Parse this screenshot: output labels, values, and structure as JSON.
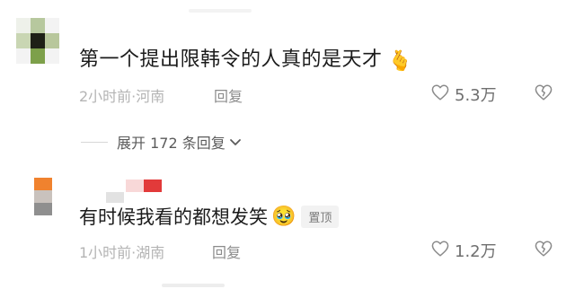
{
  "comments": [
    {
      "text": "第一个提出限韩令的人真的是天才",
      "emoji": "🫰",
      "meta": "2小时前·河南",
      "reply_label": "回复",
      "likes": "5.3万"
    },
    {
      "text": "有时候我看的都想发笑",
      "emoji": "🥹",
      "pin_label": "置顶",
      "meta": "1小时前·湖南",
      "reply_label": "回复",
      "likes": "1.2万"
    }
  ],
  "expand_replies": {
    "label": "展开 172 条回复"
  },
  "colors": {
    "text": "#1b1b1b",
    "meta": "#b4b4b4",
    "accent_red": "#e23a3a",
    "avatar_green": "#7da04a",
    "avatar_orange": "#f0822e"
  },
  "icons": {
    "like": "heart-outline-icon",
    "dislike": "broken-heart-outline-icon",
    "expand": "chevron-down-icon"
  }
}
